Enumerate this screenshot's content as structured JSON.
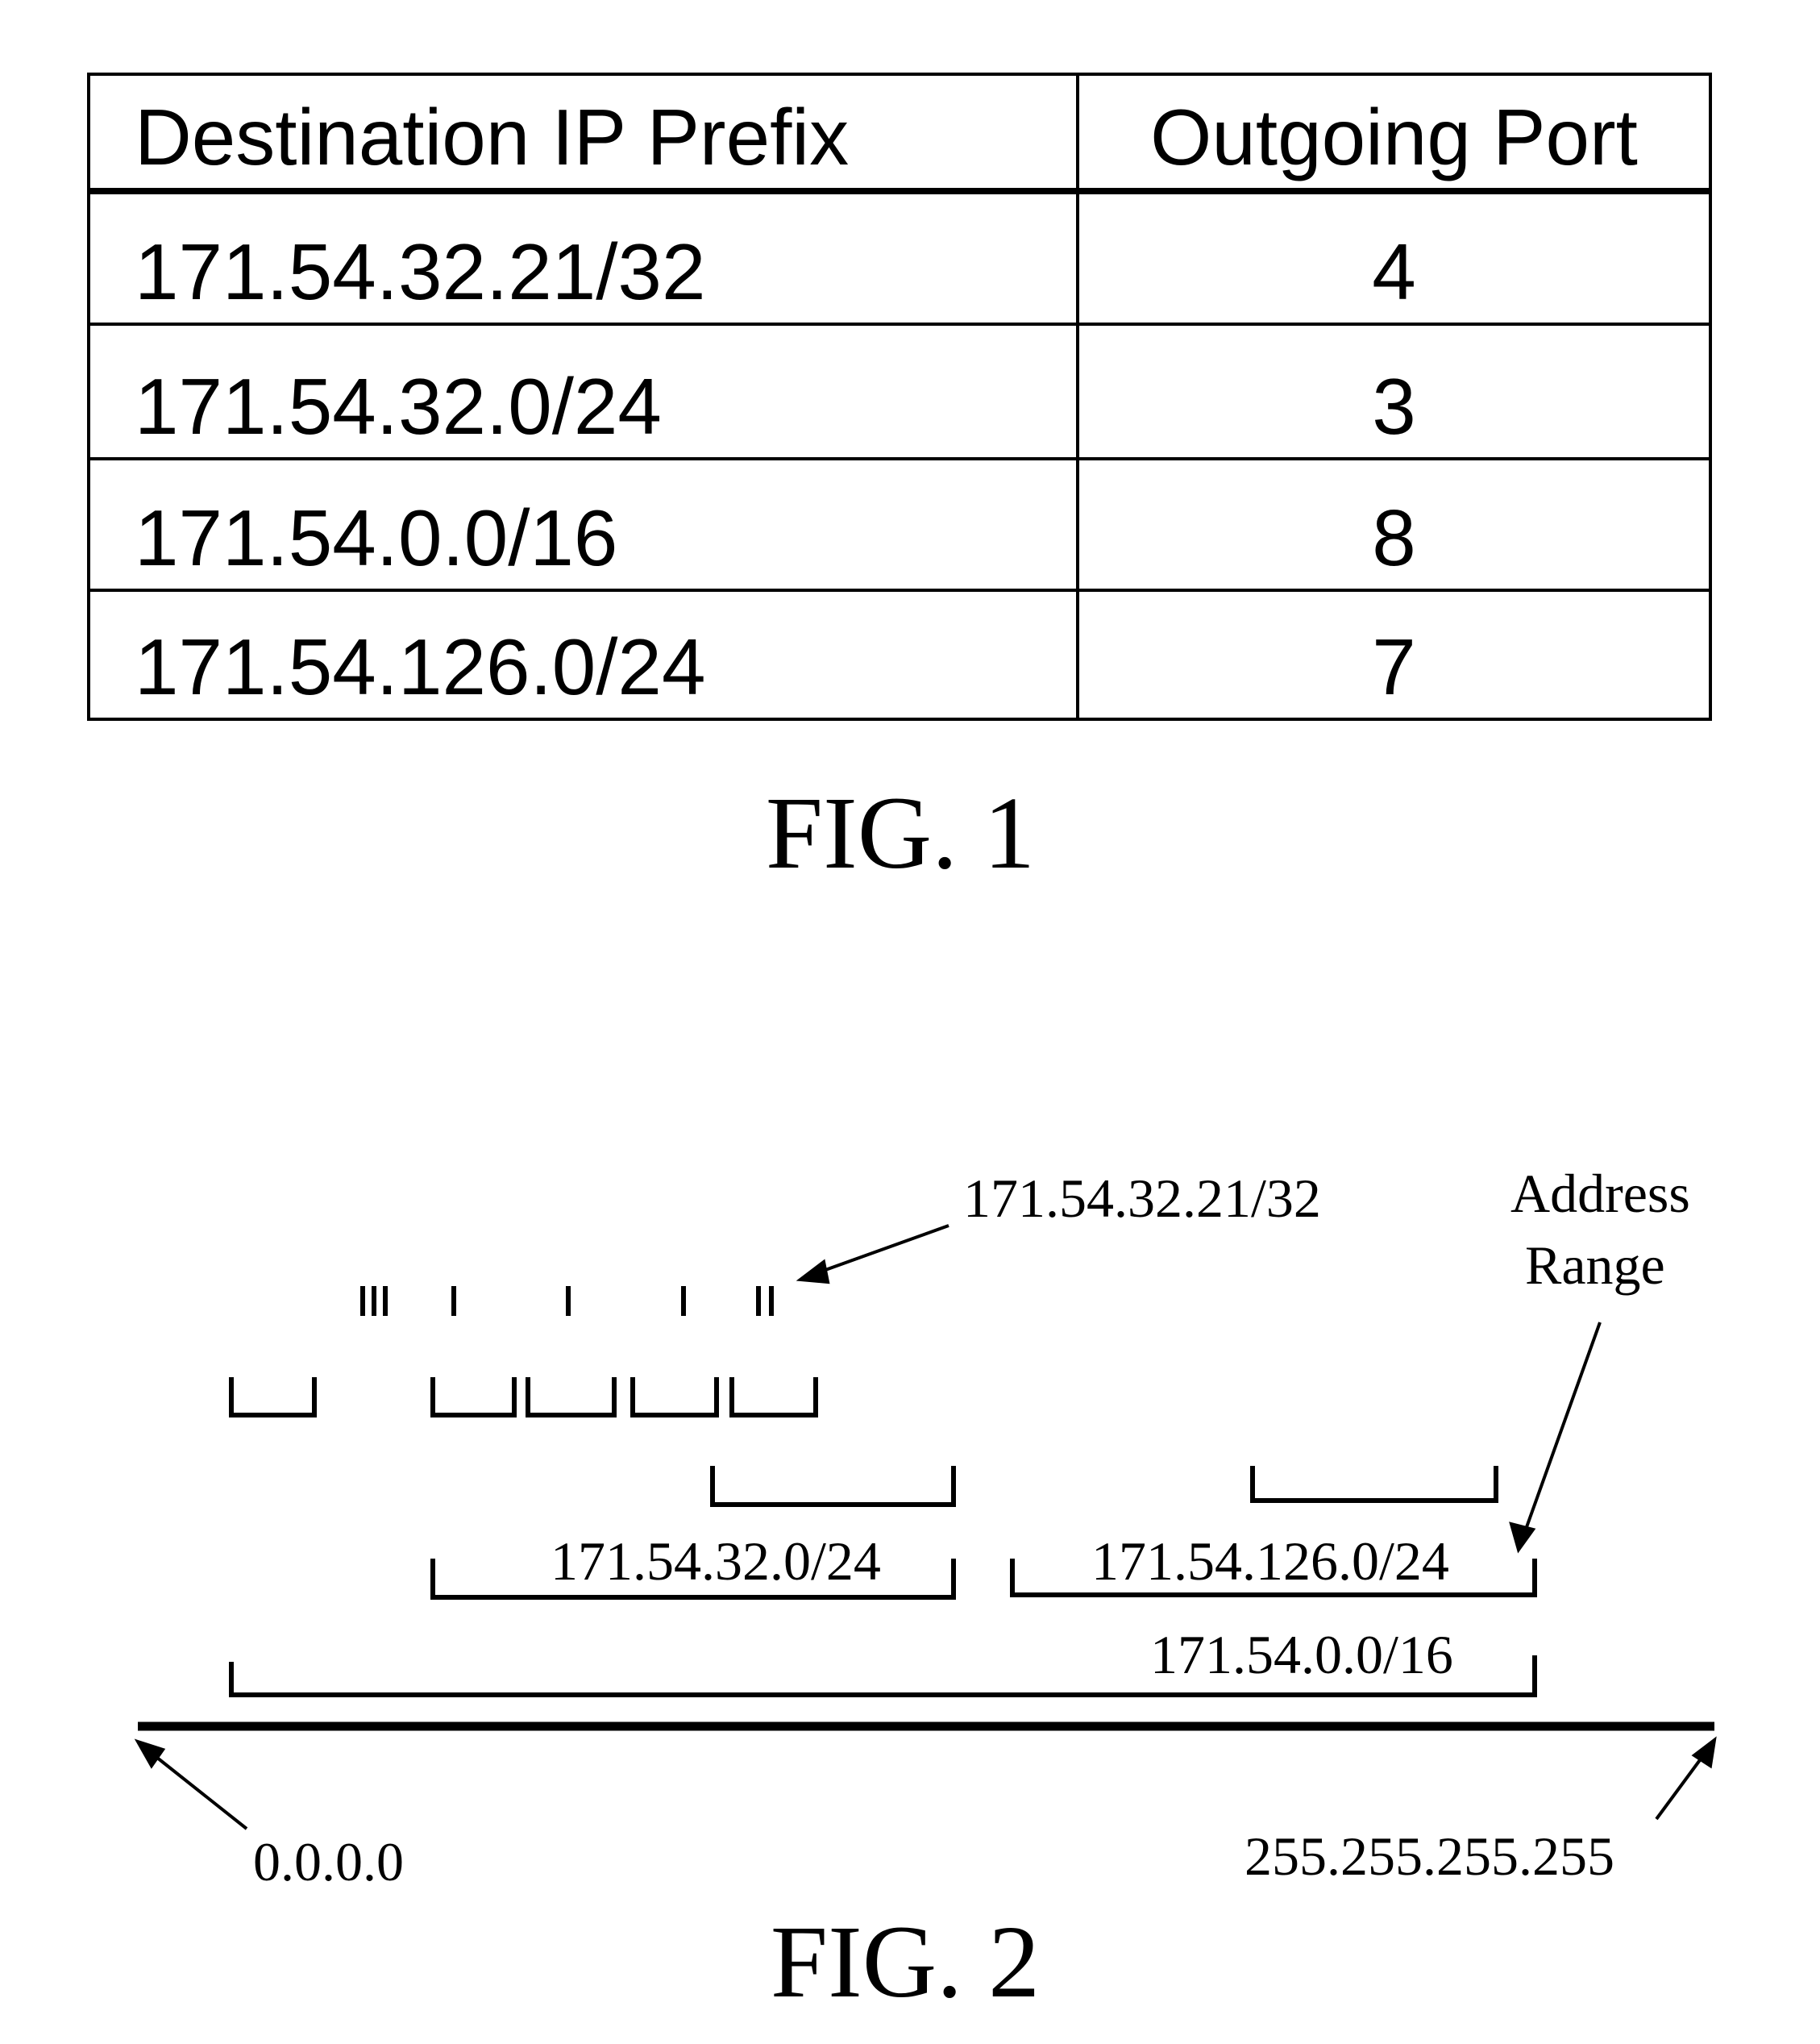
{
  "figure1": {
    "caption": "FIG. 1",
    "table": {
      "headers": [
        "Destination IP Prefix",
        "Outgoing Port"
      ],
      "rows": [
        [
          "171.54.32.21/32",
          "4"
        ],
        [
          "171.54.32.0/24",
          "3"
        ],
        [
          "171.54.0.0/16",
          "8"
        ],
        [
          "171.54.126.0/24",
          "7"
        ]
      ]
    }
  },
  "figure2": {
    "caption": "FIG. 2",
    "labels": {
      "host_prefix": "171.54.32.21/32",
      "address_range_line1": "Address",
      "address_range_line2": "Range",
      "prefix_32_0_24": "171.54.32.0/24",
      "prefix_126_0_24": "171.54.126.0/24",
      "prefix_0_0_16": "171.54.0.0/16",
      "range_start": "0.0.0.0",
      "range_end": "255.255.255.255"
    }
  }
}
